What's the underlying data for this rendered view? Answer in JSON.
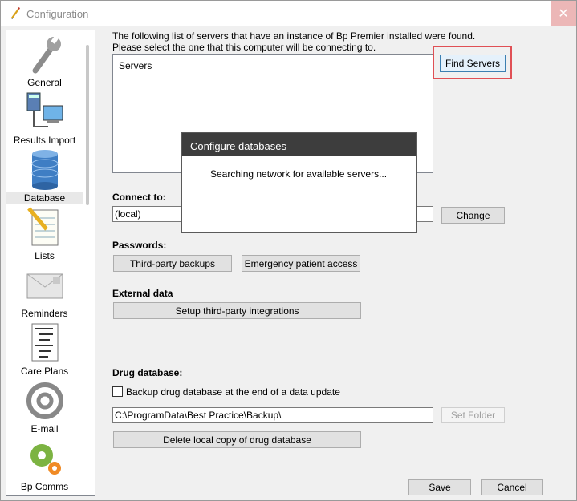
{
  "window": {
    "title": "Configuration",
    "app_icon": "pen-icon",
    "close_icon": "close-icon"
  },
  "sidebar": {
    "items": [
      {
        "label": "General",
        "icon": "wrench-icon"
      },
      {
        "label": "Results Import",
        "icon": "network-computer-icon"
      },
      {
        "label": "Database",
        "icon": "database-icon"
      },
      {
        "label": "Lists",
        "icon": "notepad-pencil-icon"
      },
      {
        "label": "Reminders",
        "icon": "envelope-icon"
      },
      {
        "label": "Care Plans",
        "icon": "tree-document-icon"
      },
      {
        "label": "E-mail",
        "icon": "at-sign-icon"
      },
      {
        "label": "Bp Comms",
        "icon": "gears-icon"
      }
    ],
    "selected": "Database"
  },
  "servers": {
    "intro_line1": "The following list of servers that have an instance of Bp Premier installed were found.",
    "intro_line2": "Please select the one that this computer will be connecting to.",
    "list_header": "Servers",
    "find_button": "Find Servers"
  },
  "connect": {
    "heading": "Connect to:",
    "value": "(local)",
    "change_button": "Change"
  },
  "passwords": {
    "heading": "Passwords:",
    "third_party_button": "Third-party backups",
    "emergency_button": "Emergency patient access"
  },
  "external": {
    "heading": "External data",
    "setup_button": "Setup third-party integrations"
  },
  "drug": {
    "heading": "Drug database:",
    "backup_checkbox_label": "Backup drug database at the end of a data update",
    "backup_checked": false,
    "folder_path": "C:\\ProgramData\\Best Practice\\Backup\\",
    "set_folder_button": "Set Folder",
    "delete_button": "Delete local copy of drug database"
  },
  "footer": {
    "save_button": "Save",
    "cancel_button": "Cancel"
  },
  "dialog": {
    "title": "Configure databases",
    "message": "Searching network for available servers..."
  },
  "colors": {
    "highlight_border": "#e05055",
    "dialog_header": "#3d3d3d",
    "close_button": "#ecb7b7"
  }
}
